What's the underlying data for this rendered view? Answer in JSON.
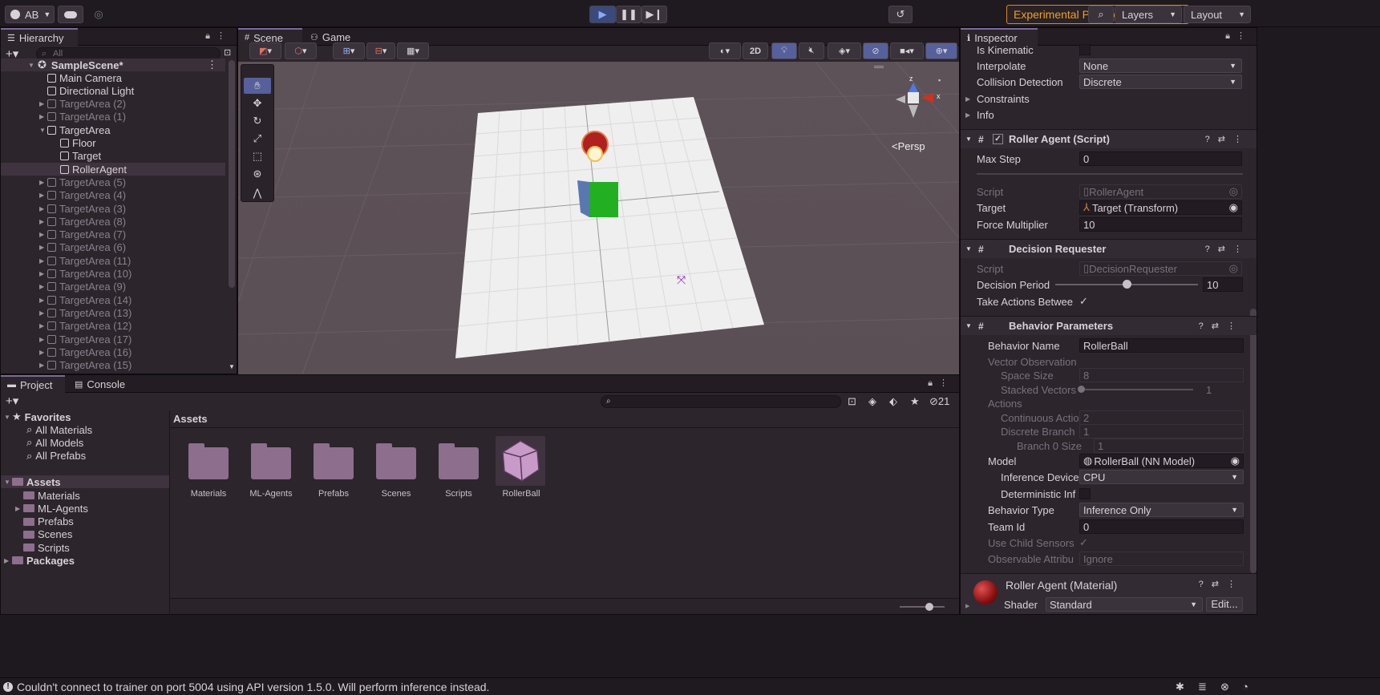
{
  "toolbar": {
    "account": "AB",
    "experimental": "Experimental Packages In Use",
    "layers": "Layers",
    "layout": "Layout"
  },
  "hierarchy": {
    "tab": "Hierarchy",
    "search_placeholder": "All",
    "scene": "SampleScene*",
    "items": [
      {
        "label": "Main Camera",
        "depth": 2,
        "dim": false,
        "sel": false,
        "arrow": ""
      },
      {
        "label": "Directional Light",
        "depth": 2,
        "dim": false,
        "sel": false,
        "arrow": ""
      },
      {
        "label": "TargetArea (2)",
        "depth": 2,
        "dim": true,
        "sel": false,
        "arrow": "▶"
      },
      {
        "label": "TargetArea (1)",
        "depth": 2,
        "dim": true,
        "sel": false,
        "arrow": "▶"
      },
      {
        "label": "TargetArea",
        "depth": 2,
        "dim": false,
        "sel": false,
        "arrow": "▼"
      },
      {
        "label": "Floor",
        "depth": 3,
        "dim": false,
        "sel": false,
        "arrow": ""
      },
      {
        "label": "Target",
        "depth": 3,
        "dim": false,
        "sel": false,
        "arrow": ""
      },
      {
        "label": "RollerAgent",
        "depth": 3,
        "dim": false,
        "sel": true,
        "arrow": ""
      },
      {
        "label": "TargetArea (5)",
        "depth": 2,
        "dim": true,
        "sel": false,
        "arrow": "▶"
      },
      {
        "label": "TargetArea (4)",
        "depth": 2,
        "dim": true,
        "sel": false,
        "arrow": "▶"
      },
      {
        "label": "TargetArea (3)",
        "depth": 2,
        "dim": true,
        "sel": false,
        "arrow": "▶"
      },
      {
        "label": "TargetArea (8)",
        "depth": 2,
        "dim": true,
        "sel": false,
        "arrow": "▶"
      },
      {
        "label": "TargetArea (7)",
        "depth": 2,
        "dim": true,
        "sel": false,
        "arrow": "▶"
      },
      {
        "label": "TargetArea (6)",
        "depth": 2,
        "dim": true,
        "sel": false,
        "arrow": "▶"
      },
      {
        "label": "TargetArea (11)",
        "depth": 2,
        "dim": true,
        "sel": false,
        "arrow": "▶"
      },
      {
        "label": "TargetArea (10)",
        "depth": 2,
        "dim": true,
        "sel": false,
        "arrow": "▶"
      },
      {
        "label": "TargetArea (9)",
        "depth": 2,
        "dim": true,
        "sel": false,
        "arrow": "▶"
      },
      {
        "label": "TargetArea (14)",
        "depth": 2,
        "dim": true,
        "sel": false,
        "arrow": "▶"
      },
      {
        "label": "TargetArea (13)",
        "depth": 2,
        "dim": true,
        "sel": false,
        "arrow": "▶"
      },
      {
        "label": "TargetArea (12)",
        "depth": 2,
        "dim": true,
        "sel": false,
        "arrow": "▶"
      },
      {
        "label": "TargetArea (17)",
        "depth": 2,
        "dim": true,
        "sel": false,
        "arrow": "▶"
      },
      {
        "label": "TargetArea (16)",
        "depth": 2,
        "dim": true,
        "sel": false,
        "arrow": "▶"
      },
      {
        "label": "TargetArea (15)",
        "depth": 2,
        "dim": true,
        "sel": false,
        "arrow": "▶"
      }
    ]
  },
  "scene": {
    "tab_scene": "Scene",
    "tab_game": "Game",
    "btn_2d": "2D",
    "persp": "<Persp",
    "gizmo_y": "y",
    "gizmo_x": "x",
    "gizmo_z": "z"
  },
  "inspector": {
    "tab": "Inspector",
    "is_kinematic": "Is Kinematic",
    "interpolate_label": "Interpolate",
    "interpolate_value": "None",
    "collision_label": "Collision Detection",
    "collision_value": "Discrete",
    "constraints": "Constraints",
    "info": "Info",
    "roller_agent_header": "Roller Agent (Script)",
    "max_step_label": "Max Step",
    "max_step_value": "0",
    "script_label": "Script",
    "script_value": "RollerAgent",
    "target_label": "Target",
    "target_value": "Target (Transform)",
    "force_label": "Force Multiplier",
    "force_value": "10",
    "decision_header": "Decision Requester",
    "dr_script_label": "Script",
    "dr_script_value": "DecisionRequester",
    "period_label": "Decision Period",
    "period_value": "10",
    "period_fraction": 0.5,
    "take_actions_label": "Take Actions Betwee",
    "take_actions_check": "✓",
    "bp_header": "Behavior Parameters",
    "behavior_name_label": "Behavior Name",
    "behavior_name_value": "RollerBall",
    "vector_obs": "Vector Observation",
    "space_size_label": "Space Size",
    "space_size_value": "8",
    "stacked_label": "Stacked Vectors",
    "stacked_value": "1",
    "actions": "Actions",
    "continuous_label": "Continuous Actio",
    "continuous_value": "2",
    "discrete_label": "Discrete Branch",
    "discrete_value": "1",
    "branch0_label": "Branch 0 Size",
    "branch0_value": "1",
    "model_label": "Model",
    "model_value": "RollerBall (NN Model)",
    "inference_label": "Inference Device",
    "inference_value": "CPU",
    "deterministic_label": "Deterministic Inf",
    "behavior_type_label": "Behavior Type",
    "behavior_type_value": "Inference Only",
    "team_id_label": "Team Id",
    "team_id_value": "0",
    "child_sensors_label": "Use Child Sensors",
    "child_sensors_check": "✓",
    "observable_label": "Observable Attribu",
    "observable_value": "Ignore",
    "material_name": "Roller Agent (Material)",
    "shader_label": "Shader",
    "shader_value": "Standard",
    "edit_button": "Edit..."
  },
  "project": {
    "tab_project": "Project",
    "tab_console": "Console",
    "favorites": "Favorites",
    "fav_items": [
      "All Materials",
      "All Models",
      "All Prefabs"
    ],
    "assets": "Assets",
    "asset_folders": [
      "Materials",
      "ML-Agents",
      "Prefabs",
      "Scenes",
      "Scripts"
    ],
    "packages": "Packages",
    "breadcrumb": "Assets",
    "grid_items": [
      "Materials",
      "ML-Agents",
      "Prefabs",
      "Scenes",
      "Scripts",
      "RollerBall"
    ],
    "hidden_count": "21"
  },
  "status": {
    "message": "Couldn't connect to trainer on port 5004 using API version 1.5.0. Will perform inference instead."
  }
}
